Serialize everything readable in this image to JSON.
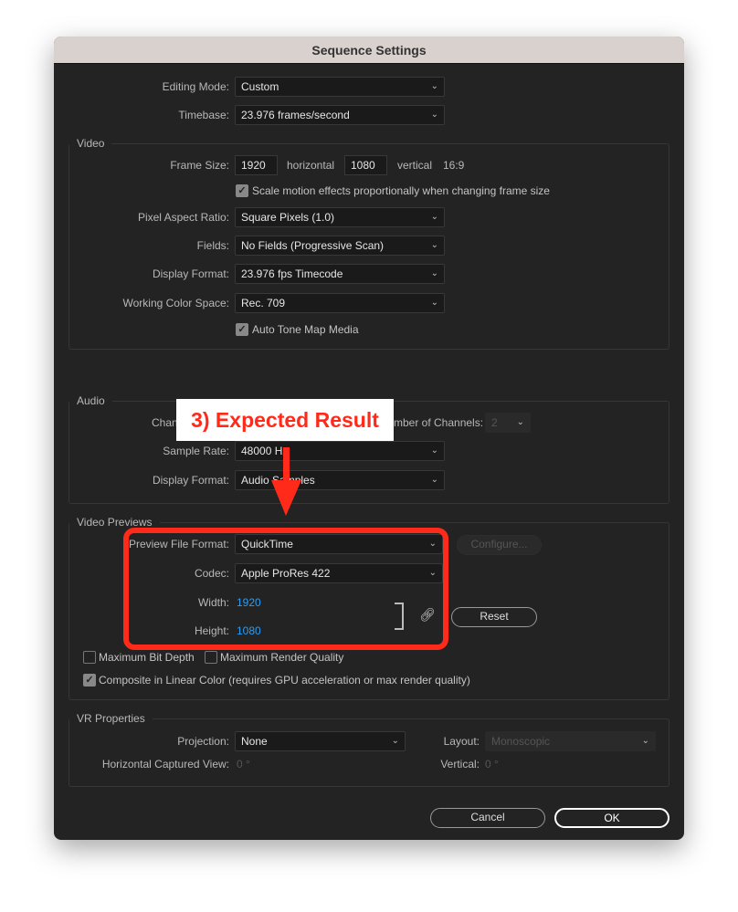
{
  "title": "Sequence Settings",
  "editing_mode": {
    "label": "Editing Mode:",
    "value": "Custom"
  },
  "timebase": {
    "label": "Timebase:",
    "value": "23.976  frames/second"
  },
  "video": {
    "group": "Video",
    "frame_size_label": "Frame Size:",
    "width": "1920",
    "horizontal": "horizontal",
    "height": "1080",
    "vertical": "vertical",
    "aspect": "16:9",
    "scale_motion": {
      "label": "Scale motion effects proportionally when changing frame size",
      "checked": true
    },
    "pixel_aspect": {
      "label": "Pixel Aspect Ratio:",
      "value": "Square Pixels (1.0)"
    },
    "fields": {
      "label": "Fields:",
      "value": "No Fields (Progressive Scan)"
    },
    "display_format": {
      "label": "Display Format:",
      "value": "23.976 fps Timecode"
    },
    "color_space": {
      "label": "Working Color Space:",
      "value": "Rec. 709"
    },
    "auto_tone": {
      "label": "Auto Tone Map Media",
      "checked": true
    }
  },
  "audio": {
    "group": "Audio",
    "channels_label": "Chan",
    "num_channels_label": "mber of Channels:",
    "num_channels": "2",
    "sample_rate": {
      "label": "Sample Rate:",
      "value": "48000 Hz"
    },
    "display_format": {
      "label": "Display Format:",
      "value": "Audio Samples"
    }
  },
  "previews": {
    "group": "Video Previews",
    "file_format": {
      "label": "Preview File Format:",
      "value": "QuickTime"
    },
    "configure": "Configure...",
    "codec": {
      "label": "Codec:",
      "value": "Apple ProRes 422"
    },
    "width_label": "Width:",
    "width": "1920",
    "height_label": "Height:",
    "height": "1080",
    "reset": "Reset",
    "max_bit_depth": {
      "label": "Maximum Bit Depth",
      "checked": false
    },
    "max_render": {
      "label": "Maximum Render Quality",
      "checked": false
    },
    "linear_color": {
      "label": "Composite in Linear Color (requires GPU acceleration or max render quality)",
      "checked": true
    }
  },
  "vr": {
    "group": "VR Properties",
    "projection": {
      "label": "Projection:",
      "value": "None"
    },
    "layout": {
      "label": "Layout:",
      "value": "Monoscopic"
    },
    "hcv_label": "Horizontal Captured View:",
    "hcv": "0 °",
    "vertical_label": "Vertical:",
    "vertical": "0 °"
  },
  "buttons": {
    "cancel": "Cancel",
    "ok": "OK"
  },
  "annotation": {
    "text": "3) Expected Result",
    "color": "#ff2a1a"
  }
}
